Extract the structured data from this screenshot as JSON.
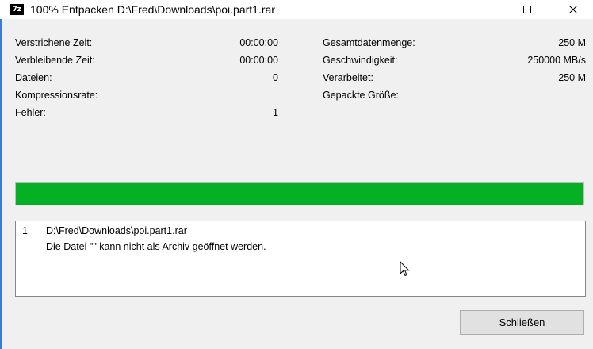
{
  "window": {
    "title": "100% Entpacken D:\\Fred\\Downloads\\poi.part1.rar",
    "icon_text": "7z",
    "icons": {
      "minimize": "minimize-icon",
      "maximize": "maximize-icon",
      "close": "close-icon"
    }
  },
  "stats": {
    "elapsed": {
      "label": "Verstrichene Zeit:",
      "value": "00:00:00"
    },
    "remaining": {
      "label": "Verbleibende Zeit:",
      "value": "00:00:00"
    },
    "files": {
      "label": "Dateien:",
      "value": "0"
    },
    "compression": {
      "label": "Kompressionsrate:",
      "value": ""
    },
    "errors": {
      "label": "Fehler:",
      "value": "1"
    },
    "total_size": {
      "label": "Gesamtdatenmenge:",
      "value": "250 M"
    },
    "speed": {
      "label": "Geschwindigkeit:",
      "value": "250000 MB/s"
    },
    "processed": {
      "label": "Verarbeitet:",
      "value": "250 M"
    },
    "packed_size": {
      "label": "Gepackte Größe:",
      "value": ""
    }
  },
  "progress": {
    "percent": 100,
    "color": "#06b025"
  },
  "log": {
    "rows": [
      {
        "num": "1",
        "text": "D:\\Fred\\Downloads\\poi.part1.rar"
      },
      {
        "num": "",
        "text": "Die Datei \"\" kann nicht als Archiv geöffnet werden."
      }
    ]
  },
  "buttons": {
    "close_label": "Schließen"
  }
}
